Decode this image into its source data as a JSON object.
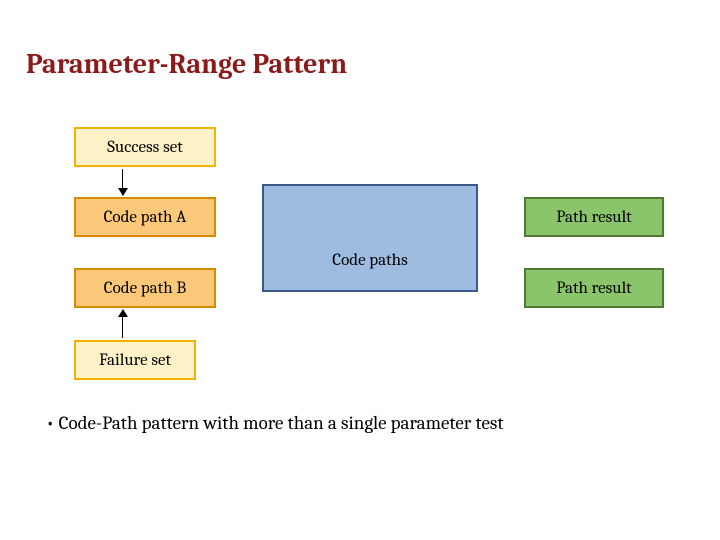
{
  "title": "Parameter-Range Pattern",
  "boxes": {
    "success": "Success set",
    "pathA": "Code path A",
    "pathB": "Code path B",
    "center": "Code paths",
    "res1": "Path result",
    "res2": "Path result",
    "failure": "Failure set"
  },
  "bullet": "Code-Path pattern with  more than a single parameter test"
}
